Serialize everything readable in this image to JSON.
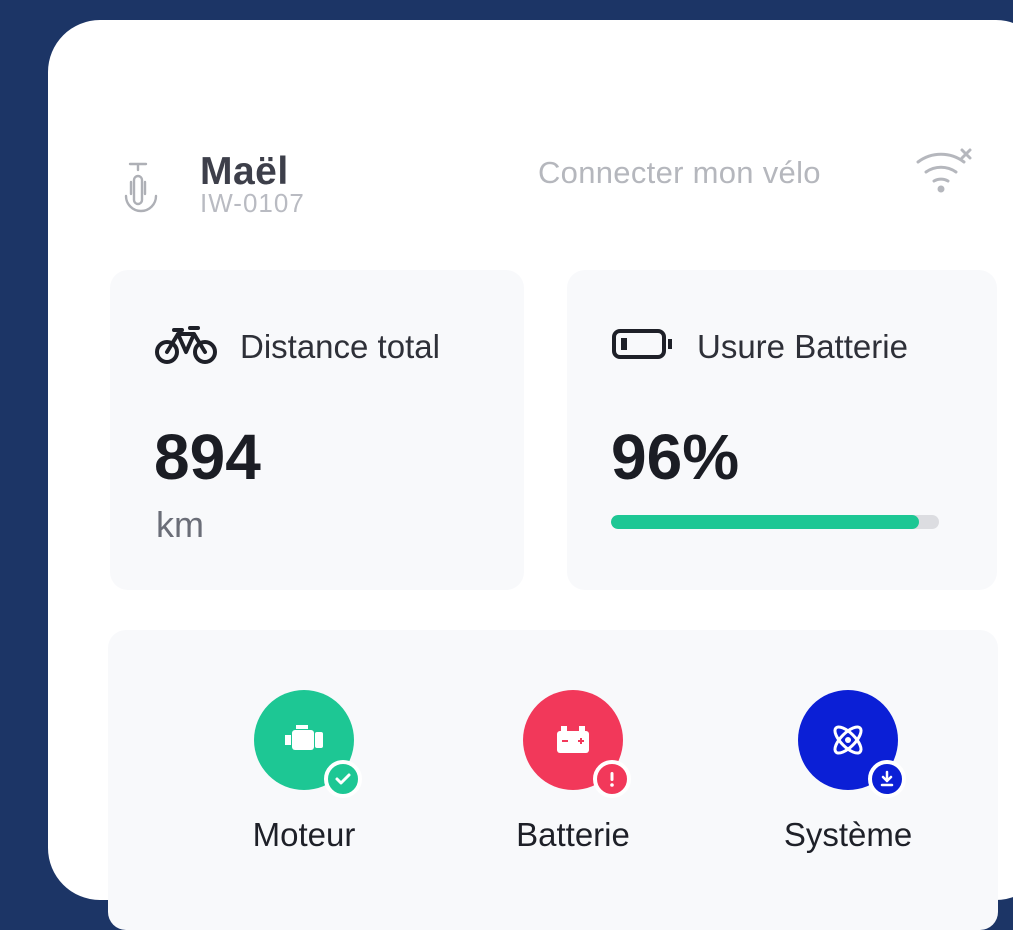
{
  "header": {
    "rider_name": "Maël",
    "bike_id": "IW-0107",
    "connect_label": "Connecter mon vélo"
  },
  "stats": {
    "distance": {
      "title": "Distance total",
      "value": "894",
      "unit": "km"
    },
    "battery": {
      "title": "Usure Batterie",
      "value": "96%",
      "level": 0.94
    }
  },
  "diagnostics": [
    {
      "label": "Moteur",
      "icon": "engine-icon",
      "color": "#1dc794",
      "status": "ok",
      "badge_icon": "check-icon"
    },
    {
      "label": "Batterie",
      "icon": "car-battery-icon",
      "color": "#f2385a",
      "status": "alert",
      "badge_icon": "exclamation-icon"
    },
    {
      "label": "Système",
      "icon": "atom-icon",
      "color": "#0b1fd6",
      "status": "update",
      "badge_icon": "download-icon"
    }
  ],
  "colors": {
    "background": "#1c3566",
    "success": "#1dc794",
    "danger": "#f2385a",
    "primary": "#0b1fd6"
  }
}
